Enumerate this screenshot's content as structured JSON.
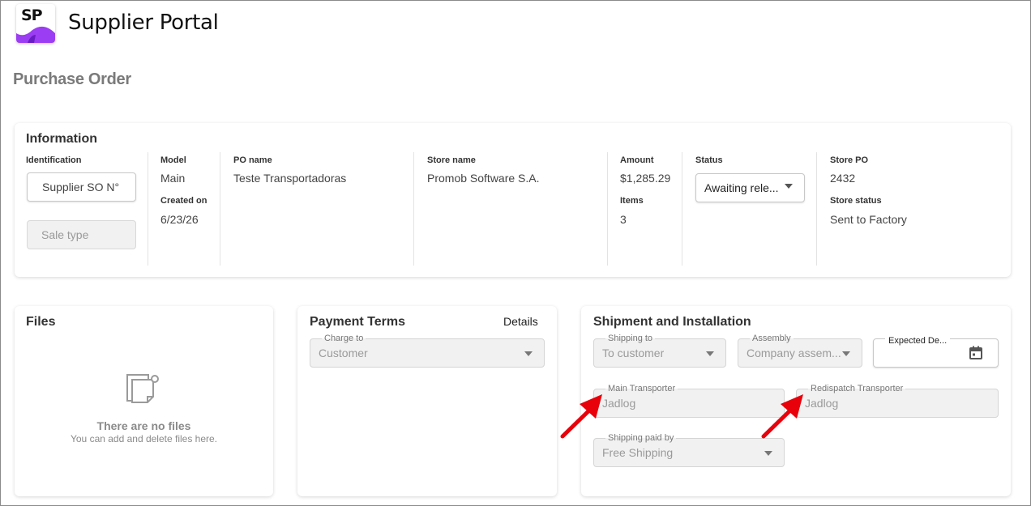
{
  "app": {
    "logo_text": "SP",
    "title": "Supplier Portal"
  },
  "page": {
    "title": "Purchase Order"
  },
  "information": {
    "title": "Information",
    "identification_label": "Identification",
    "supplier_so_button": "Supplier SO N°",
    "sale_type_button": "Sale type",
    "model_label": "Model",
    "model_value": "Main",
    "created_on_label": "Created on",
    "created_on_value": "6/23/26",
    "po_name_label": "PO name",
    "po_name_value": "Teste Transportadoras",
    "store_name_label": "Store name",
    "store_name_value": "Promob Software S.A.",
    "amount_label": "Amount",
    "amount_value": "$1,285.29",
    "items_label": "Items",
    "items_value": "3",
    "status_label": "Status",
    "status_value": "Awaiting rele...",
    "store_po_label": "Store PO",
    "store_po_value": "2432",
    "store_status_label": "Store status",
    "store_status_value": "Sent to Factory"
  },
  "files": {
    "title": "Files",
    "empty_title": "There are no files",
    "empty_sub": "You can add and delete files here."
  },
  "payment_terms": {
    "title": "Payment Terms",
    "details_link": "Details",
    "charge_to_label": "Charge to",
    "charge_to_value": "Customer"
  },
  "shipment": {
    "title": "Shipment and Installation",
    "shipping_to_label": "Shipping to",
    "shipping_to_value": "To customer",
    "assembly_label": "Assembly",
    "assembly_value": "Company assem...",
    "expected_label": "Expected De...",
    "main_transporter_label": "Main Transporter",
    "main_transporter_value": "Jadlog",
    "redispatch_label": "Redispatch Transporter",
    "redispatch_value": "Jadlog",
    "shipping_paid_label": "Shipping paid by",
    "shipping_paid_value": "Free Shipping"
  },
  "colors": {
    "accent": "#9b3df2",
    "annotation_arrow": "#e8000b"
  }
}
